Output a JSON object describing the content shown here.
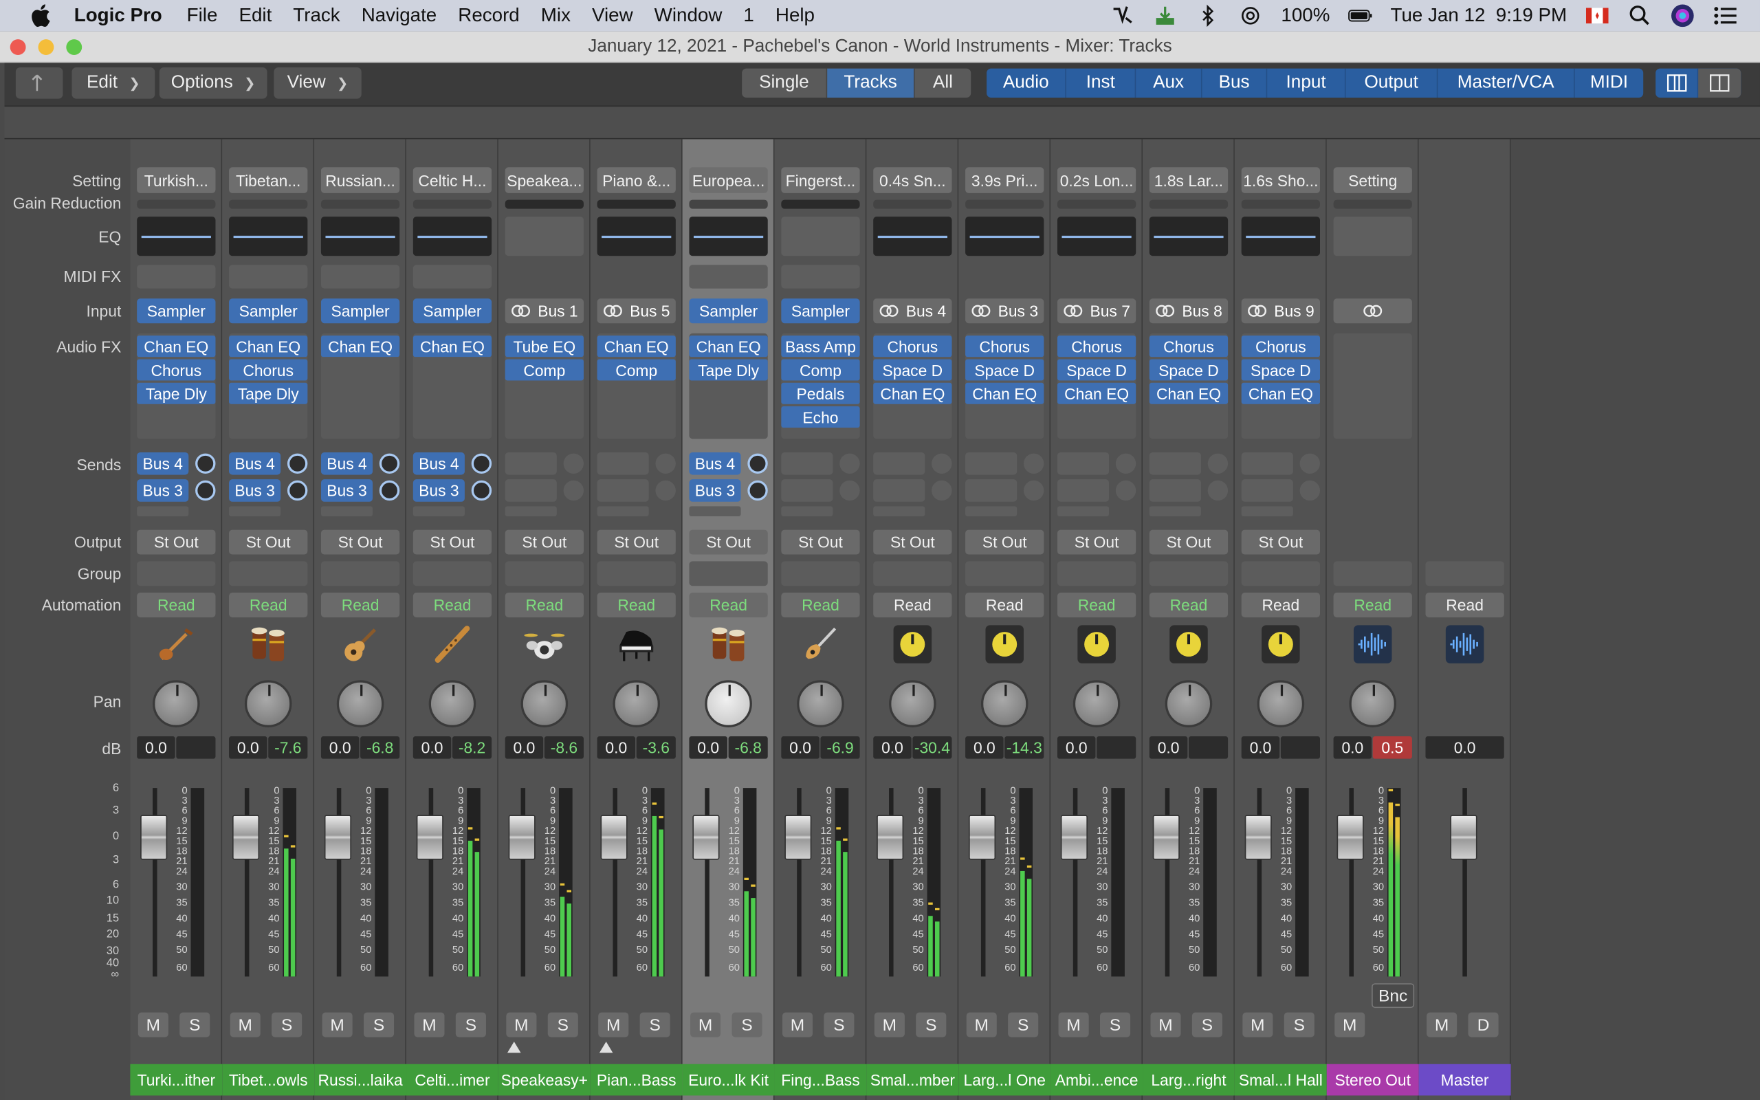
{
  "menubar": {
    "app": "Logic Pro",
    "items": [
      "File",
      "Edit",
      "Track",
      "Navigate",
      "Record",
      "Mix",
      "View",
      "Window",
      "1",
      "Help"
    ],
    "battery": "100%",
    "datetime": "Tue Jan 12  9:19 PM"
  },
  "window": {
    "title": "January 12, 2021 - Pachebel's Canon - World Instruments - Mixer: Tracks"
  },
  "toolbar": {
    "menus": [
      "Edit",
      "Options",
      "View"
    ],
    "view_modes": [
      "Single",
      "Tracks",
      "All"
    ],
    "active_view_mode": "Tracks",
    "filters": [
      "Audio",
      "Inst",
      "Aux",
      "Bus",
      "Input",
      "Output",
      "Master/VCA",
      "MIDI"
    ]
  },
  "row_labels": {
    "setting": "Setting",
    "gain_reduction": "Gain Reduction",
    "eq": "EQ",
    "midi_fx": "MIDI FX",
    "input": "Input",
    "audio_fx": "Audio FX",
    "sends": "Sends",
    "output": "Output",
    "group": "Group",
    "automation": "Automation",
    "pan": "Pan",
    "db": "dB"
  },
  "db_scale": [
    "6",
    "3",
    "0",
    "3",
    "6",
    "10",
    "15",
    "20",
    "30",
    "40",
    "∞"
  ],
  "meter_scale": [
    "0",
    "3",
    "6",
    "9",
    "12",
    "15",
    "18",
    "21",
    "24",
    "30",
    "35",
    "40",
    "45",
    "50",
    "60"
  ],
  "strips": [
    {
      "setting": "Turkish...",
      "eq": true,
      "midifx": true,
      "input": "Sampler",
      "input_bus": false,
      "fx": [
        "Chan EQ",
        "Chorus",
        "Tape Dly"
      ],
      "sends": [
        "Bus 4",
        "Bus 3"
      ],
      "output": "St Out",
      "automation": "Read",
      "auto_green": true,
      "icon": "saz-icon",
      "volume": "0.0",
      "peak": "",
      "meter": 0,
      "name": "Turki...ither",
      "name_color": "#3f9d3a",
      "mute": "M",
      "solo": "S"
    },
    {
      "setting": "Tibetan...",
      "eq": true,
      "midifx": true,
      "input": "Sampler",
      "input_bus": false,
      "fx": [
        "Chan EQ",
        "Chorus",
        "Tape Dly"
      ],
      "sends": [
        "Bus 4",
        "Bus 3"
      ],
      "output": "St Out",
      "automation": "Read",
      "auto_green": true,
      "icon": "bongo-icon",
      "volume": "0.0",
      "peak": "-7.6",
      "meter": 0.68,
      "name": "Tibet...owls",
      "name_color": "#3f9d3a",
      "mute": "M",
      "solo": "S"
    },
    {
      "setting": "Russian...",
      "eq": true,
      "midifx": true,
      "input": "Sampler",
      "input_bus": false,
      "fx": [
        "Chan EQ"
      ],
      "sends": [
        "Bus 4",
        "Bus 3"
      ],
      "output": "St Out",
      "automation": "Read",
      "auto_green": true,
      "icon": "guitar-icon",
      "volume": "0.0",
      "peak": "-6.8",
      "meter": 0,
      "name": "Russi...laika",
      "name_color": "#3f9d3a",
      "mute": "M",
      "solo": "S"
    },
    {
      "setting": "Celtic H...",
      "eq": true,
      "midifx": true,
      "input": "Sampler",
      "input_bus": false,
      "fx": [
        "Chan EQ"
      ],
      "sends": [
        "Bus 4",
        "Bus 3"
      ],
      "output": "St Out",
      "automation": "Read",
      "auto_green": true,
      "icon": "flute-icon",
      "volume": "0.0",
      "peak": "-8.2",
      "meter": 0.72,
      "name": "Celti...imer",
      "name_color": "#3f9d3a",
      "mute": "M",
      "solo": "S"
    },
    {
      "setting": "Speakea...",
      "eq": false,
      "midifx": false,
      "input": "Bus 1",
      "input_bus": true,
      "fx": [
        "Tube EQ",
        "Comp"
      ],
      "sends": [],
      "output": "St Out",
      "automation": "Read",
      "auto_green": true,
      "icon": "drums-icon",
      "volume": "0.0",
      "peak": "-8.6",
      "meter": 0.42,
      "name": "Speakeasy+",
      "name_color": "#3f9d3a",
      "mute": "M",
      "solo": "S"
    },
    {
      "setting": "Piano &...",
      "eq": true,
      "midifx": false,
      "input": "Bus 5",
      "input_bus": true,
      "fx": [
        "Chan EQ",
        "Comp"
      ],
      "sends": [],
      "output": "St Out",
      "automation": "Read",
      "auto_green": true,
      "icon": "piano-icon",
      "volume": "0.0",
      "peak": "-3.6",
      "meter": 0.85,
      "name": "Pian...Bass",
      "name_color": "#3f9d3a",
      "mute": "M",
      "solo": "S"
    },
    {
      "setting": "Europea...",
      "eq": true,
      "midifx": true,
      "input": "Sampler",
      "input_bus": false,
      "fx": [
        "Chan EQ",
        "Tape Dly"
      ],
      "sends": [
        "Bus 4",
        "Bus 3"
      ],
      "output": "St Out",
      "automation": "Read",
      "auto_green": true,
      "icon": "bongo-icon",
      "volume": "0.0",
      "peak": "-6.8",
      "meter": 0.45,
      "name": "Euro...lk Kit",
      "name_color": "#3f9d3a",
      "mute": "M",
      "solo": "S"
    },
    {
      "setting": "Fingerst...",
      "eq": false,
      "midifx": true,
      "input": "Sampler",
      "input_bus": false,
      "fx": [
        "Bass Amp",
        "Comp",
        "Pedals",
        "Echo"
      ],
      "sends": [],
      "output": "St Out",
      "automation": "Read",
      "auto_green": true,
      "icon": "electric-guitar-icon",
      "volume": "0.0",
      "peak": "-6.9",
      "meter": 0.72,
      "name": "Fing...Bass",
      "name_color": "#3f9d3a",
      "mute": "M",
      "solo": "S"
    },
    {
      "setting": "0.4s Sn...",
      "eq": true,
      "midifx": false,
      "input": "Bus 4",
      "input_bus": true,
      "fx": [
        "Chorus",
        "Space D",
        "Chan EQ"
      ],
      "sends": [],
      "output": "St Out",
      "automation": "Read",
      "auto_green": false,
      "icon": "aux-knob-icon",
      "volume": "0.0",
      "peak": "-30.4",
      "meter": 0.32,
      "name": "Smal...mber",
      "name_color": "#3f9d3a",
      "mute": "M",
      "solo": "S"
    },
    {
      "setting": "3.9s Pri...",
      "eq": true,
      "midifx": false,
      "input": "Bus 3",
      "input_bus": true,
      "fx": [
        "Chorus",
        "Space D",
        "Chan EQ"
      ],
      "sends": [],
      "output": "St Out",
      "automation": "Read",
      "auto_green": false,
      "icon": "aux-knob-icon",
      "volume": "0.0",
      "peak": "-14.3",
      "meter": 0.56,
      "name": "Larg...l One",
      "name_color": "#3f9d3a",
      "mute": "M",
      "solo": "S"
    },
    {
      "setting": "0.2s Lon...",
      "eq": true,
      "midifx": false,
      "input": "Bus 7",
      "input_bus": true,
      "fx": [
        "Chorus",
        "Space D",
        "Chan EQ"
      ],
      "sends": [],
      "output": "St Out",
      "automation": "Read",
      "auto_green": true,
      "icon": "aux-knob-icon",
      "volume": "0.0",
      "peak": "",
      "meter": 0,
      "name": "Ambi...ence",
      "name_color": "#3f9d3a",
      "mute": "M",
      "solo": "S"
    },
    {
      "setting": "1.8s Lar...",
      "eq": true,
      "midifx": false,
      "input": "Bus 8",
      "input_bus": true,
      "fx": [
        "Chorus",
        "Space D",
        "Chan EQ"
      ],
      "sends": [],
      "output": "St Out",
      "automation": "Read",
      "auto_green": true,
      "icon": "aux-knob-icon",
      "volume": "0.0",
      "peak": "",
      "meter": 0,
      "name": "Larg...right",
      "name_color": "#3f9d3a",
      "mute": "M",
      "solo": "S"
    },
    {
      "setting": "1.6s Sho...",
      "eq": true,
      "midifx": false,
      "input": "Bus 9",
      "input_bus": true,
      "fx": [
        "Chorus",
        "Space D",
        "Chan EQ"
      ],
      "sends": [],
      "output": "St Out",
      "automation": "Read",
      "auto_green": false,
      "icon": "aux-knob-icon",
      "volume": "0.0",
      "peak": "",
      "meter": 0,
      "name": "Smal...l Hall",
      "name_color": "#3f9d3a",
      "mute": "M",
      "solo": "S"
    },
    {
      "setting": "Setting",
      "eq": false,
      "midifx": false,
      "input": "",
      "input_bus": true,
      "fx": [],
      "sends": [],
      "output": "",
      "automation": "Read",
      "auto_green": true,
      "icon": "waveform-icon",
      "volume": "0.0",
      "peak": "0.5",
      "meter": 0.92,
      "name": "Stereo Out",
      "name_color": "#a93aa9",
      "mute": "M",
      "solo": "",
      "bnc": "Bnc",
      "stereo": true
    },
    {
      "setting": "",
      "eq": false,
      "midifx": false,
      "input": "",
      "input_bus": false,
      "fx": [],
      "sends": [],
      "output": "",
      "automation": "Read",
      "auto_green": false,
      "icon": "waveform-icon",
      "volume": "0.0",
      "peak": "",
      "meter": 0,
      "name": "Master",
      "name_color": "#6c4bc7",
      "mute": "M",
      "solo": "D",
      "master": true
    }
  ]
}
